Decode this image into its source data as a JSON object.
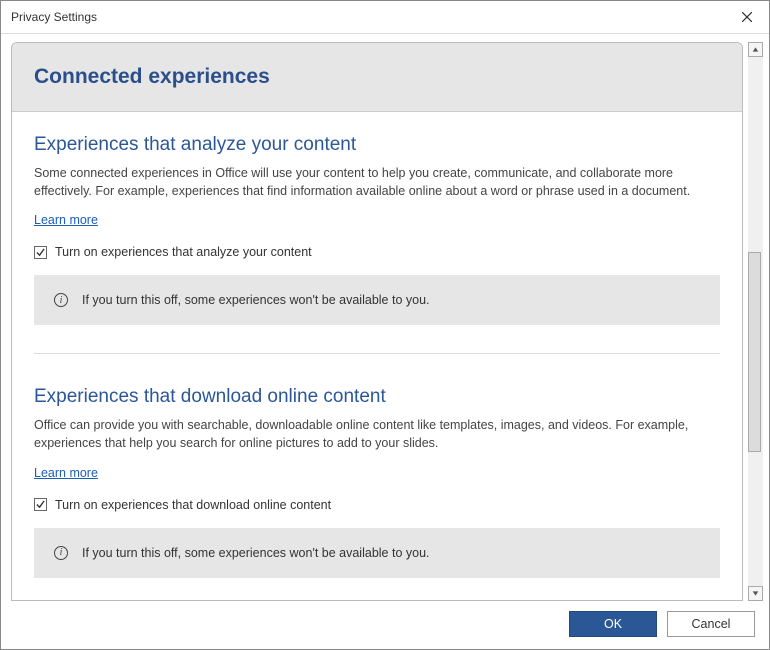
{
  "dialog": {
    "title": "Privacy Settings"
  },
  "header": {
    "title": "Connected experiences"
  },
  "sections": [
    {
      "title": "Experiences that analyze your content",
      "description": "Some connected experiences in Office will use your content to help you create, communicate, and collaborate more effectively. For example, experiences that find information available online about a word or phrase used in a document.",
      "learn_more": "Learn more",
      "checkbox_label": "Turn on experiences that analyze your content",
      "checkbox_checked": true,
      "info_text": "If you turn this off, some experiences won't be available to you."
    },
    {
      "title": "Experiences that download online content",
      "description": "Office can provide you with searchable, downloadable online content like templates, images, and videos. For example, experiences that help you search for online pictures to add to your slides.",
      "learn_more": "Learn more",
      "checkbox_label": "Turn on experiences that download online content",
      "checkbox_checked": true,
      "info_text": "If you turn this off, some experiences won't be available to you."
    }
  ],
  "footer": {
    "ok": "OK",
    "cancel": "Cancel"
  }
}
